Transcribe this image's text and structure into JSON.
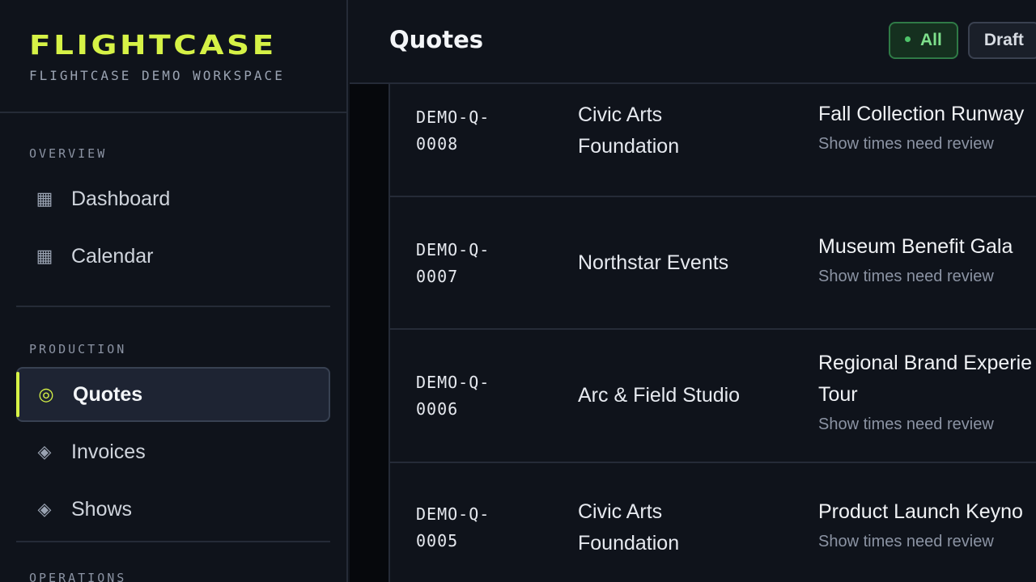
{
  "sidebar": {
    "brand_name": "FLIGHTCASE",
    "workspace": "FLIGHTCASE DEMO WORKSPACE",
    "sections": [
      {
        "label": "OVERVIEW",
        "items": [
          {
            "label": "Dashboard",
            "icon": "grid-icon",
            "glyph": "▦"
          },
          {
            "label": "Calendar",
            "icon": "calendar-icon",
            "glyph": "▦"
          }
        ]
      },
      {
        "label": "PRODUCTION",
        "items": [
          {
            "label": "Quotes",
            "icon": "target-icon",
            "glyph": "◎",
            "active": true
          },
          {
            "label": "Invoices",
            "icon": "diamond-icon",
            "glyph": "◈"
          },
          {
            "label": "Shows",
            "icon": "diamond-icon",
            "glyph": "◈"
          }
        ]
      },
      {
        "label": "OPERATIONS"
      }
    ]
  },
  "header": {
    "title": "Quotes",
    "filters": [
      {
        "label": "All",
        "active": true
      },
      {
        "label": "Draft",
        "active": false
      }
    ]
  },
  "quotes": [
    {
      "id_line1": "DEMO-Q-",
      "id_line2": "0008",
      "client_line1": "Civic Arts",
      "client_line2": "Foundation",
      "show_title": "Fall Collection Runway",
      "show_title_2": "",
      "note": "Show times need review"
    },
    {
      "id_line1": "DEMO-Q-",
      "id_line2": "0007",
      "client_line1": "Northstar Events",
      "client_line2": "",
      "show_title": "Museum Benefit Gala",
      "show_title_2": "",
      "note": "Show times need review"
    },
    {
      "id_line1": "DEMO-Q-",
      "id_line2": "0006",
      "client_line1": "Arc & Field Studio",
      "client_line2": "",
      "show_title": "Regional Brand Experie",
      "show_title_2": "Tour",
      "note": "Show times need review"
    },
    {
      "id_line1": "DEMO-Q-",
      "id_line2": "0005",
      "client_line1": "Civic Arts",
      "client_line2": "Foundation",
      "show_title": "Product Launch Keyno",
      "show_title_2": "",
      "note": "Show times need review"
    }
  ],
  "colors": {
    "accent": "#d6f246",
    "background": "#0f131b",
    "active_filter": "#7ee08c"
  }
}
